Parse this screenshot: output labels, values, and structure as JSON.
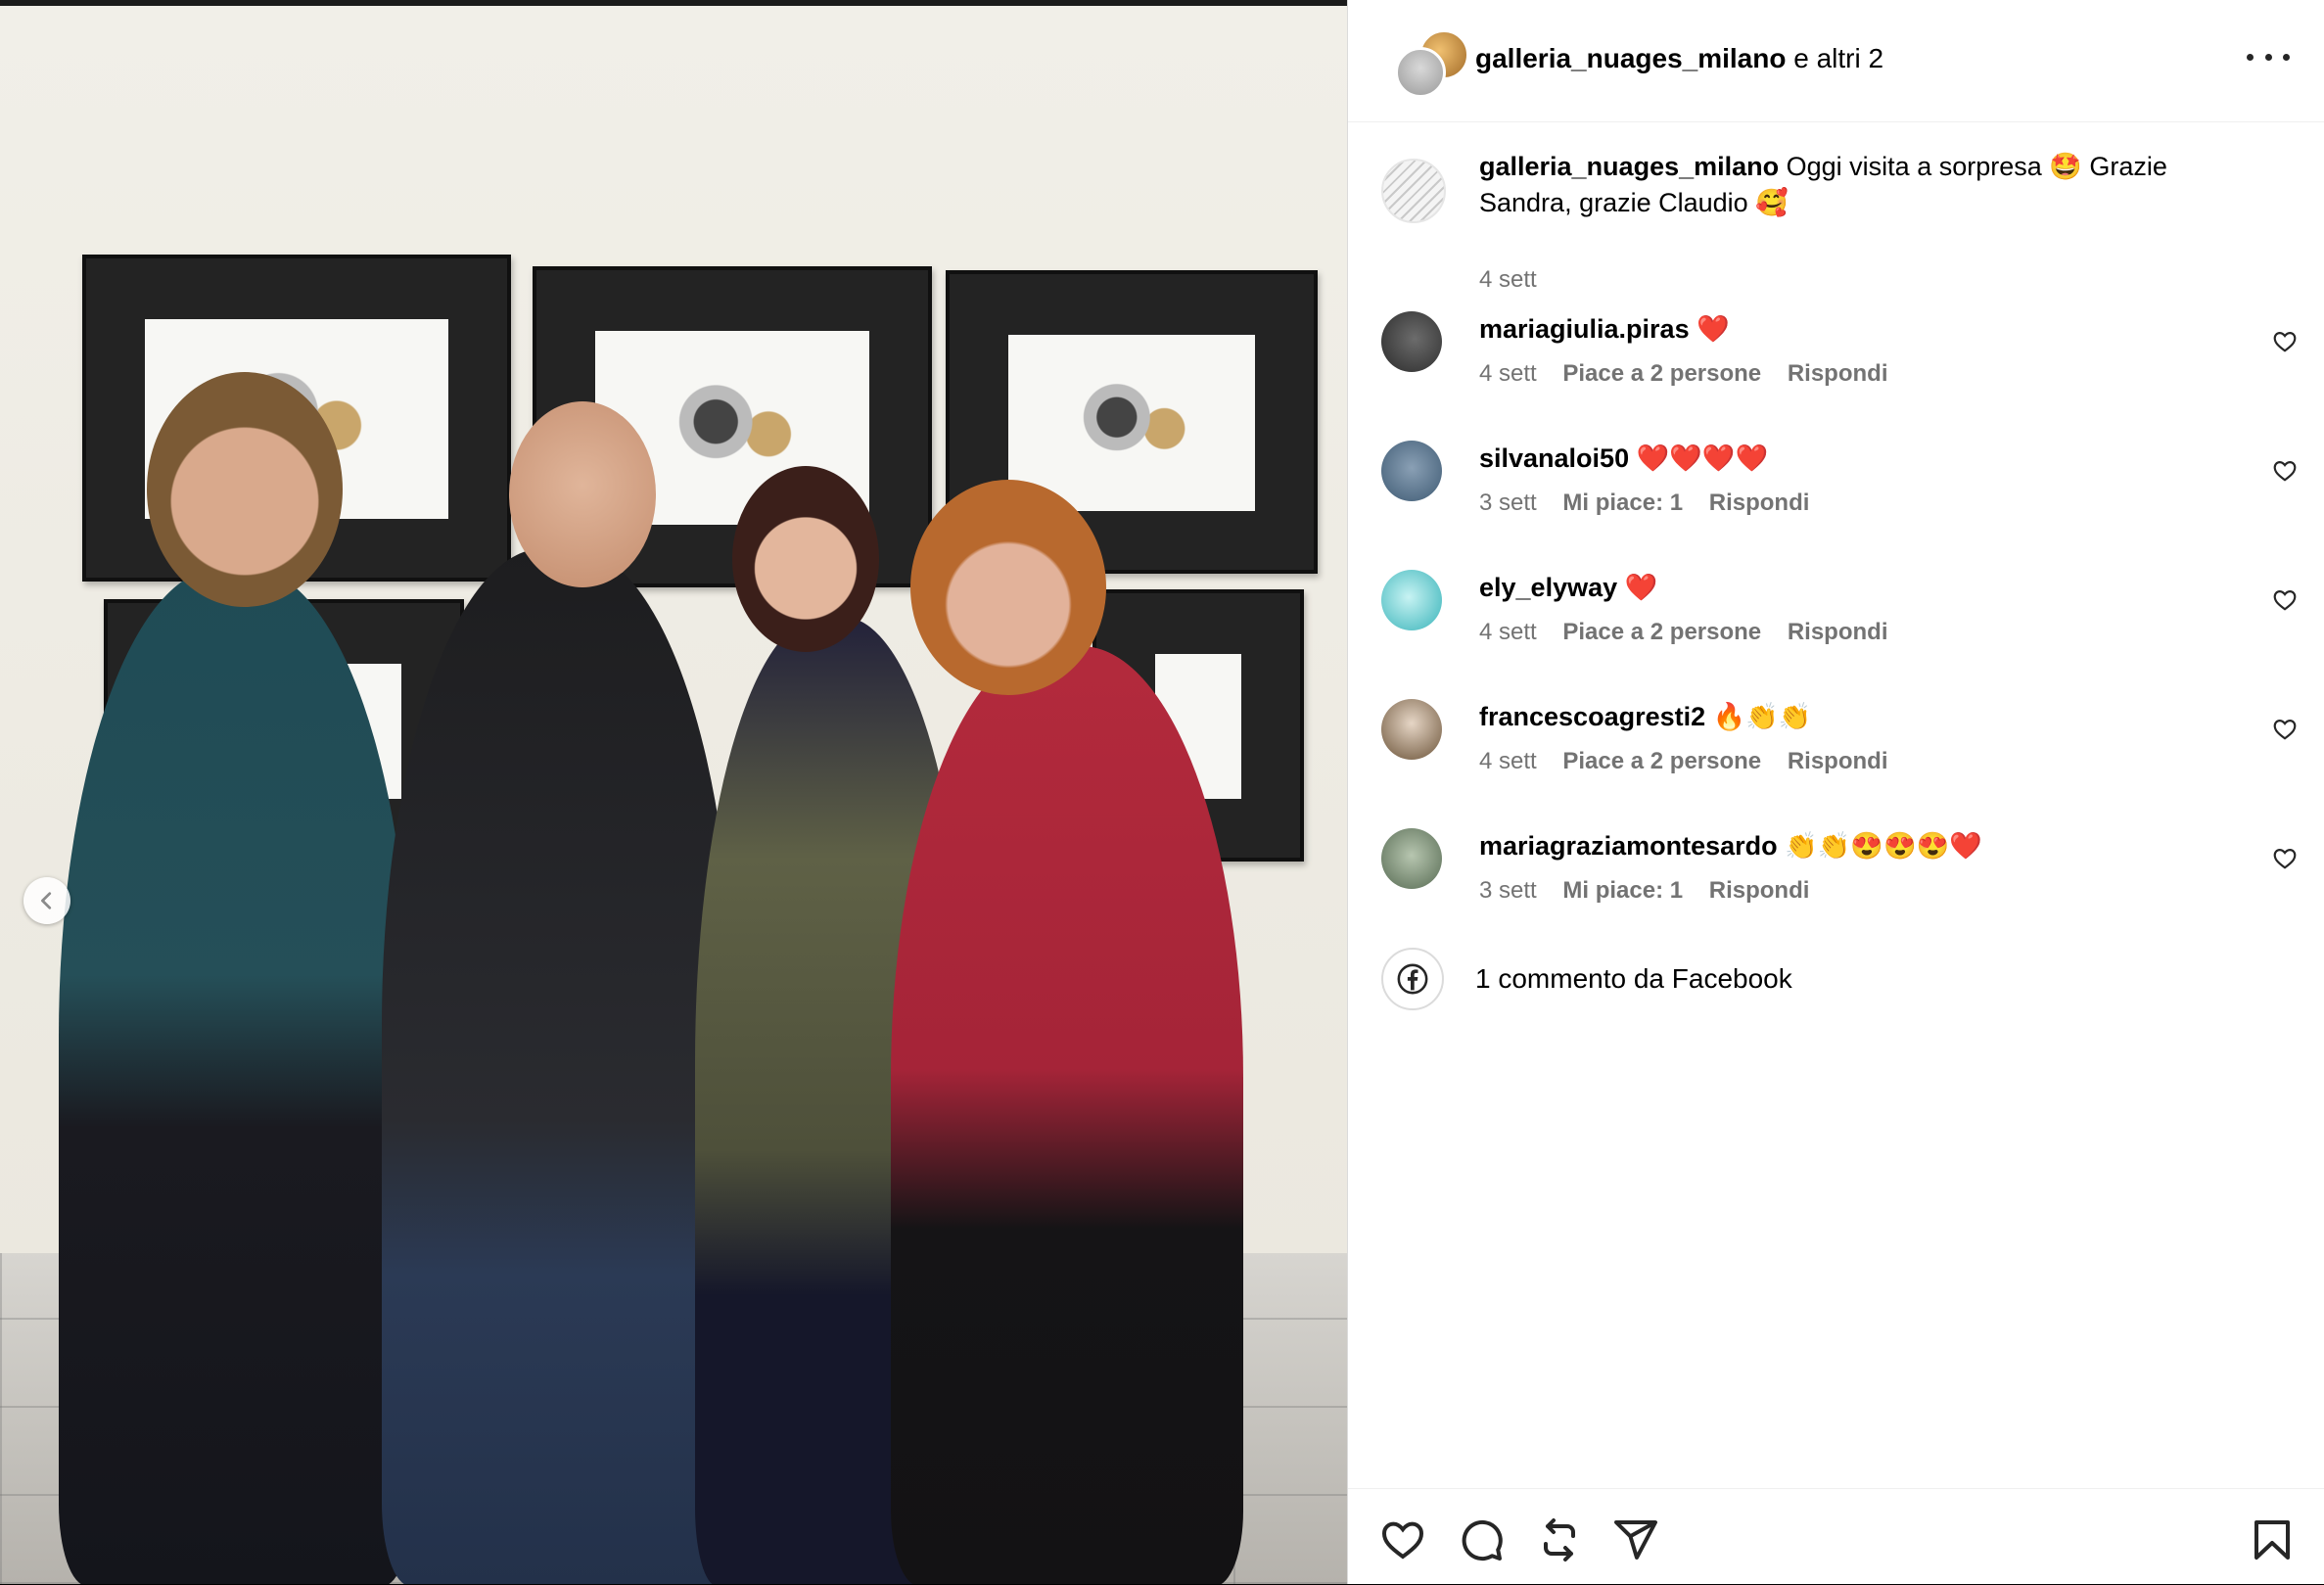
{
  "post": {
    "authors": "galleria_nuages_milano",
    "authors_suffix": "e altri 2"
  },
  "caption": {
    "user": "galleria_nuages_milano",
    "text": "Oggi visita a sorpresa 🤩 Grazie Sandra, grazie Claudio 🥰",
    "time": "4 sett"
  },
  "comments": [
    {
      "user": "mariagiulia.piras",
      "text": "❤️",
      "time": "4 sett",
      "likes": "Piace a 2 persone",
      "reply": "Rispondi"
    },
    {
      "user": "silvanaloi50",
      "text": "❤️❤️❤️❤️",
      "time": "3 sett",
      "likes": "Mi piace: 1",
      "reply": "Rispondi"
    },
    {
      "user": "ely_elyway",
      "text": "❤️",
      "time": "4 sett",
      "likes": "Piace a 2 persone",
      "reply": "Rispondi"
    },
    {
      "user": "francescoagresti2",
      "text": "🔥👏👏",
      "time": "4 sett",
      "likes": "Piace a 2 persone",
      "reply": "Rispondi"
    },
    {
      "user": "mariagraziamontesardo",
      "text": "👏👏😍😍😍❤️",
      "time": "3 sett",
      "likes": "Mi piace: 1",
      "reply": "Rispondi"
    }
  ],
  "facebook": {
    "label": "1 commento da Facebook"
  },
  "icons": {
    "more": "more-options-icon",
    "like": "heart-icon",
    "comment": "comment-icon",
    "repost": "repost-icon",
    "share": "send-icon",
    "save": "bookmark-icon",
    "prev": "chevron-left-icon",
    "facebook": "facebook-icon"
  }
}
